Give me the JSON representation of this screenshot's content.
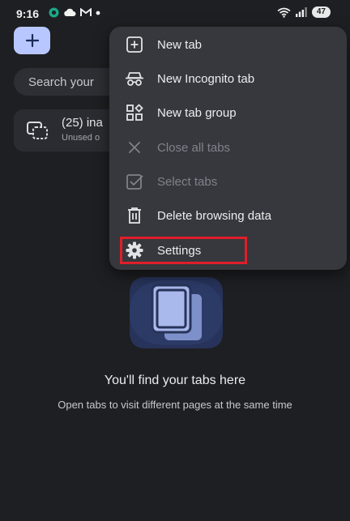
{
  "status_bar": {
    "time": "9:16",
    "battery": "47"
  },
  "background": {
    "search_placeholder": "Search your",
    "inactive_tabs": {
      "title": "(25) ina",
      "subtitle": "Unused o"
    },
    "empty_state": {
      "title": "You'll find your tabs here",
      "subtitle": "Open tabs to visit different pages at the same time"
    }
  },
  "menu": {
    "items": [
      {
        "label": "New tab",
        "icon": "new-tab-icon",
        "enabled": true
      },
      {
        "label": "New Incognito tab",
        "icon": "incognito-icon",
        "enabled": true
      },
      {
        "label": "New tab group",
        "icon": "tab-group-icon",
        "enabled": true
      },
      {
        "label": "Close all tabs",
        "icon": "close-icon",
        "enabled": false
      },
      {
        "label": "Select tabs",
        "icon": "select-checkbox-icon",
        "enabled": false
      },
      {
        "label": "Delete browsing data",
        "icon": "trash-icon",
        "enabled": true
      },
      {
        "label": "Settings",
        "icon": "gear-icon",
        "enabled": true
      }
    ]
  },
  "colors": {
    "background": "#1e1f22",
    "menu_bg": "#36383d",
    "accent_fab": "#b8c7ff",
    "highlight": "#e01e2a"
  }
}
